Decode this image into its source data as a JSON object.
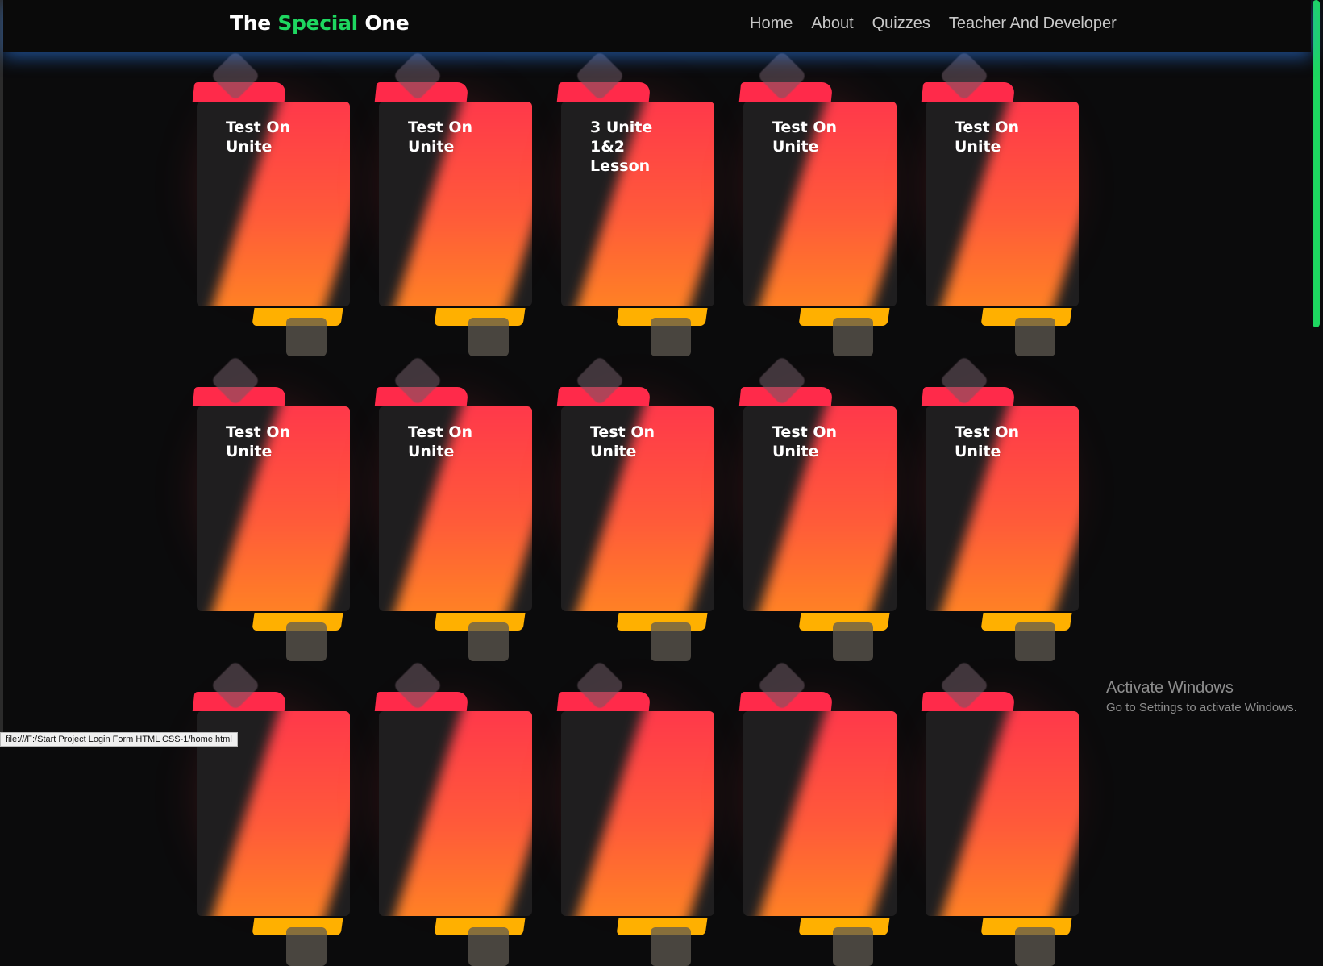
{
  "header": {
    "brand": {
      "part1": "The",
      "accent": "Special",
      "part3": "One"
    },
    "nav": [
      "Home",
      "About",
      "Quizzes",
      "Teacher And Developer"
    ]
  },
  "cards": [
    [
      "Test On",
      "Unite"
    ],
    [
      "Test On",
      "Unite"
    ],
    [
      "3 Unite",
      "1&2",
      "Lesson"
    ],
    [
      "Test On",
      "Unite"
    ],
    [
      "Test On",
      "Unite"
    ],
    [
      "Test On",
      "Unite"
    ],
    [
      "Test On",
      "Unite"
    ],
    [
      "Test On",
      "Unite"
    ],
    [
      "Test On",
      "Unite"
    ],
    [
      "Test On",
      "Unite"
    ],
    [],
    [],
    [],
    [],
    []
  ],
  "status_bar": {
    "url": "file:///F:/Start Project Login Form HTML CSS-1/home.html"
  },
  "watermark": {
    "title": "Activate Windows",
    "subtitle": "Go to Settings to activate Windows."
  },
  "colors": {
    "accent_green": "#1ed760",
    "header_line_blue": "#2f86ff",
    "card_red": "#ff2a4a",
    "card_orange": "#ffb000"
  }
}
